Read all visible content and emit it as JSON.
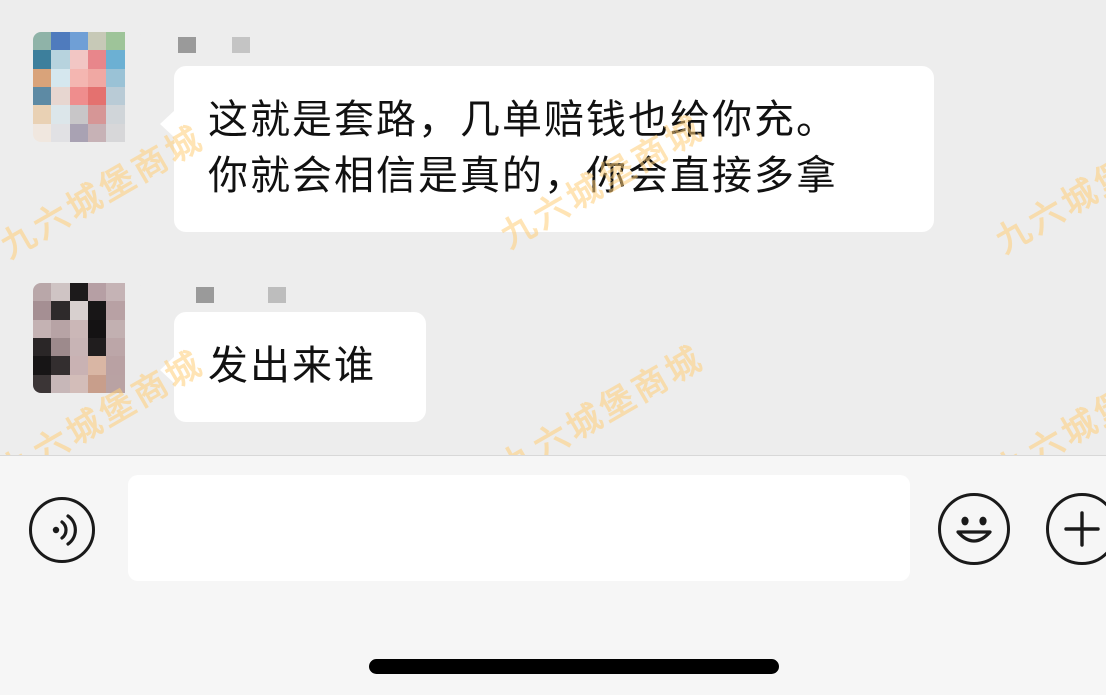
{
  "messages": [
    {
      "text": "这就是套路，几单赔钱也给你充。\n你就会相信是真的，你会直接多拿"
    },
    {
      "text": "发出来谁"
    }
  ],
  "watermark": {
    "text": "九六城堡商城"
  },
  "input": {
    "value": "",
    "placeholder": ""
  },
  "icons": {
    "voice": "voice-icon",
    "emoji": "emoji-icon",
    "plus": "plus-icon"
  },
  "colors": {
    "chat_background": "#ededed",
    "bubble": "#ffffff",
    "input_bar": "#f6f6f6",
    "watermark": "#ffcd78"
  }
}
